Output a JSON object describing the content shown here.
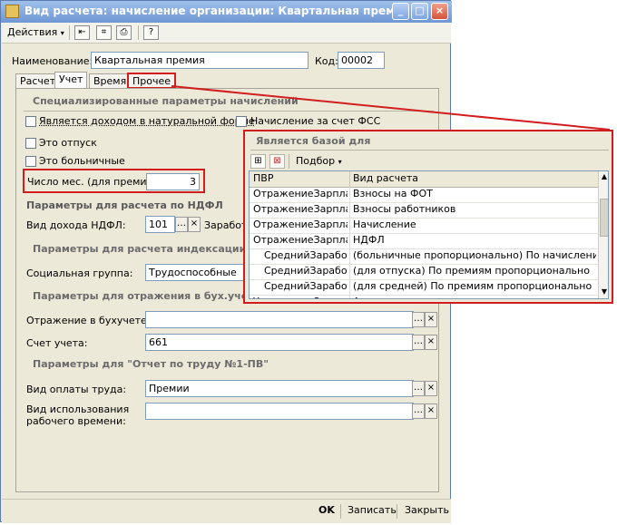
{
  "window": {
    "title": "Вид расчета: начисление организации: Квартальная премия",
    "controls": {
      "minimize": "_",
      "maximize": "□",
      "close": "×"
    }
  },
  "toolbar": {
    "actions_label": "Действия",
    "help": "?"
  },
  "header": {
    "name_label": "Наименование:",
    "name_value": "Квартальная премия",
    "code_label": "Код:",
    "code_value": "00002"
  },
  "tabs": [
    "Расчет",
    "Учет",
    "Время",
    "Прочее"
  ],
  "panel": {
    "section_special": "Специализированные параметры начислений",
    "chk_natural": "Является доходом в натуральной форме",
    "chk_fss": "Начисление за счет ФСС",
    "chk_vacation": "Это отпуск",
    "chk_sick": "Это больничные",
    "months_label": "Число мес. (для премии):",
    "months_value": "3",
    "section_ndfl": "Параметры для расчета по НДФЛ",
    "income_label": "Вид дохода НДФЛ:",
    "income_value": "101",
    "income_extra": "Заработ",
    "section_index": "Параметры для расчета индексации",
    "social_label": "Социальная группа:",
    "social_value": "Трудоспособные",
    "section_accounting": "Параметры для отражения в бух.учете",
    "reflect_label": "Отражение в бухучете:",
    "reflect_value": "",
    "account_label": "Счет учета:",
    "account_value": "661",
    "section_report": "Параметры для \"Отчет по труду №1-ПВ\"",
    "pay_label": "Вид оплаты труда:",
    "pay_value": "Премии",
    "worktime_label1": "Вид использования",
    "worktime_label2": "рабочего времени:",
    "worktime_value": ""
  },
  "bottom": {
    "ok": "OK",
    "save": "Записать",
    "close": "Закрыть"
  },
  "popup": {
    "title": "Является базой для",
    "select_label": "Подбор",
    "columns": [
      "ПВР",
      "Вид расчета"
    ],
    "rows": [
      [
        "ОтражениеЗарплат...",
        "Взносы на ФОТ"
      ],
      [
        "ОтражениеЗарплат...",
        "Взносы работников"
      ],
      [
        "ОтражениеЗарплат...",
        "Начисление"
      ],
      [
        "ОтражениеЗарплат...",
        "НДФЛ"
      ],
      [
        "СреднийЗаработок",
        "(больничные пропорционально) По начислениям, ..."
      ],
      [
        "СреднийЗаработок",
        "(для отпуска) По премиям пропорционально"
      ],
      [
        "СреднийЗаработок",
        "(для средней) По премиям пропорционально"
      ],
      [
        "УдержанияОргани...",
        "Алименты процентом"
      ]
    ]
  }
}
